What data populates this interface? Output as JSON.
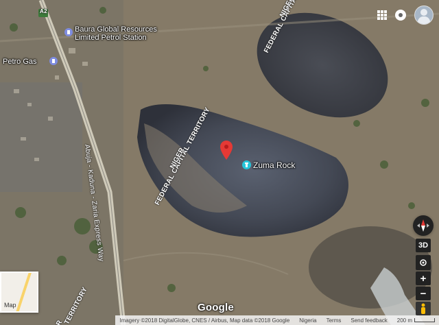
{
  "places": {
    "fuel_station": "Baura Global Resources Limited Petrol Station",
    "fuel_station_line1": "Baura Global Resources",
    "fuel_station_line2": "Limited Petrol Station",
    "gas": "Petro Gas",
    "landmark": "Zuma Rock"
  },
  "boundaries": {
    "niger": "NIGER",
    "fct": "FEDERAL CAPITAL TERRITORY",
    "fct_top": "NIGER",
    "fct_top2": "FEDERAL CAPITAL",
    "bottom": "TERRITORY",
    "bottom_prefix": "R"
  },
  "road": {
    "name": "Abuja - Kaduna - Zaria Express Way",
    "shield": "A2"
  },
  "controls": {
    "tilt_label": "3D",
    "zoom_in": "+",
    "zoom_out": "−"
  },
  "minimap_label": "Map",
  "logo": "Google",
  "footer": {
    "imagery": "Imagery ©2018 DigitalGlobe, CNES / Airbus, Map data ©2018 Google",
    "region": "Nigeria",
    "terms": "Terms",
    "feedback": "Send feedback",
    "scale": "200 m"
  },
  "colors": {
    "marker": "#e53935",
    "landmark_icon": "#26c6da",
    "fuel_icon": "#7e8ce0",
    "road": "#cfcab9"
  }
}
